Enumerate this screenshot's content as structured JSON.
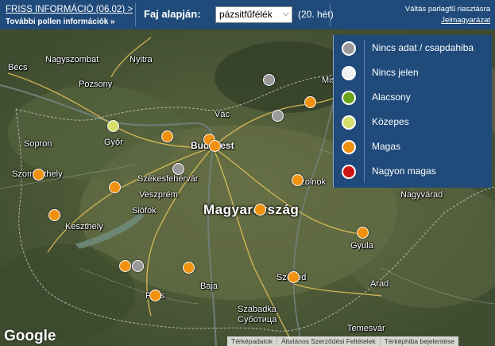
{
  "header": {
    "fresh_info": "FRISS INFORMÁCIÓ (06.02) >",
    "more_info": "További pollen információk »",
    "species_label": "Faj alapján:",
    "species_value": "pázsitfűfélék",
    "week": "(20. hét)",
    "switch_link": "Váltás parlagfű riasztásra",
    "legend_link": "Jelmagyarázat"
  },
  "legend": [
    {
      "label": "Nincs adat / csapdahiba",
      "color": "#9a9a9a"
    },
    {
      "label": "Nincs jelen",
      "color": "#f2f2f2"
    },
    {
      "label": "Alacsony",
      "color": "#6aa31c"
    },
    {
      "label": "Közepes",
      "color": "#d7df6c"
    },
    {
      "label": "Magas",
      "color": "#f0920f"
    },
    {
      "label": "Nagyon magas",
      "color": "#d01414"
    }
  ],
  "map": {
    "country": "Magyarország",
    "cities": [
      "Bécs",
      "Nagyszombat",
      "Nyitra",
      "Pozsony",
      "Győr",
      "Sopron",
      "Szombathely",
      "Székesfehérvár",
      "Veszprém",
      "Siófok",
      "Keszthely",
      "Budapest",
      "Vác",
      "Szolnok",
      "Baja",
      "Pécs",
      "Szeged",
      "Szabadka",
      "Суботица",
      "Arad",
      "Gyula",
      "Nagyvárad",
      "Temesvár",
      "Miskolc"
    ],
    "markers": [
      "grey",
      "orange",
      "grey",
      "orange",
      "yellow",
      "orange",
      "orange",
      "orange",
      "grey",
      "orange",
      "orange",
      "orange",
      "orange",
      "orange",
      "orange",
      "orange",
      "orange",
      "grey",
      "orange",
      "orange",
      "orange",
      "grey",
      "orange"
    ]
  },
  "footer": {
    "google": "Google",
    "attrib": [
      "Térképadatok",
      "Általános Szerződési Feltételek",
      "Térképhiba bejelentése"
    ]
  },
  "colors": {
    "header_bg": "#1f4a7a",
    "magas": "#f0920f",
    "kozepes": "#d7df6c",
    "nincs_adat": "#9a9a9a"
  }
}
